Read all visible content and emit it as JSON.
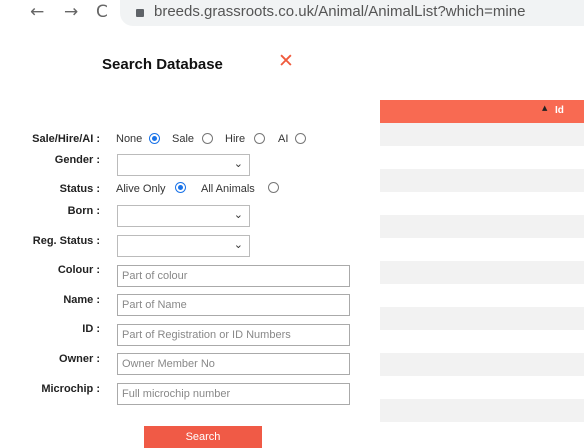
{
  "browser": {
    "back_icon": "←",
    "forward_icon": "→",
    "reload_icon": "C",
    "url": "breeds.grassroots.co.uk/Animal/AnimalList?which=mine"
  },
  "dialog": {
    "title": "Search Database",
    "close_icon": "✕",
    "fields": {
      "sale_hire_ai": {
        "label": "Sale/Hire/AI :",
        "options": [
          "None",
          "Sale",
          "Hire",
          "AI"
        ],
        "selected": "None"
      },
      "gender": {
        "label": "Gender :",
        "value": ""
      },
      "status": {
        "label": "Status :",
        "options": [
          "Alive Only",
          "All Animals"
        ],
        "selected": "Alive Only"
      },
      "born": {
        "label": "Born :",
        "value": ""
      },
      "reg_status": {
        "label": "Reg. Status :",
        "value": ""
      },
      "colour": {
        "label": "Colour :",
        "placeholder": "Part of colour"
      },
      "name": {
        "label": "Name :",
        "placeholder": "Part of Name"
      },
      "id": {
        "label": "ID :",
        "placeholder": "Part of Registration or ID Numbers"
      },
      "owner": {
        "label": "Owner :",
        "placeholder": "Owner Member No"
      },
      "microchip": {
        "label": "Microchip :",
        "placeholder": "Full microchip number"
      }
    },
    "search_label": "Search",
    "chevron": "⌄"
  },
  "table": {
    "sort_indicator": "▲",
    "column_header": "Id"
  },
  "colors": {
    "accent": "#f05a46",
    "header": "#f86a52",
    "radio": "#1a73e8"
  }
}
